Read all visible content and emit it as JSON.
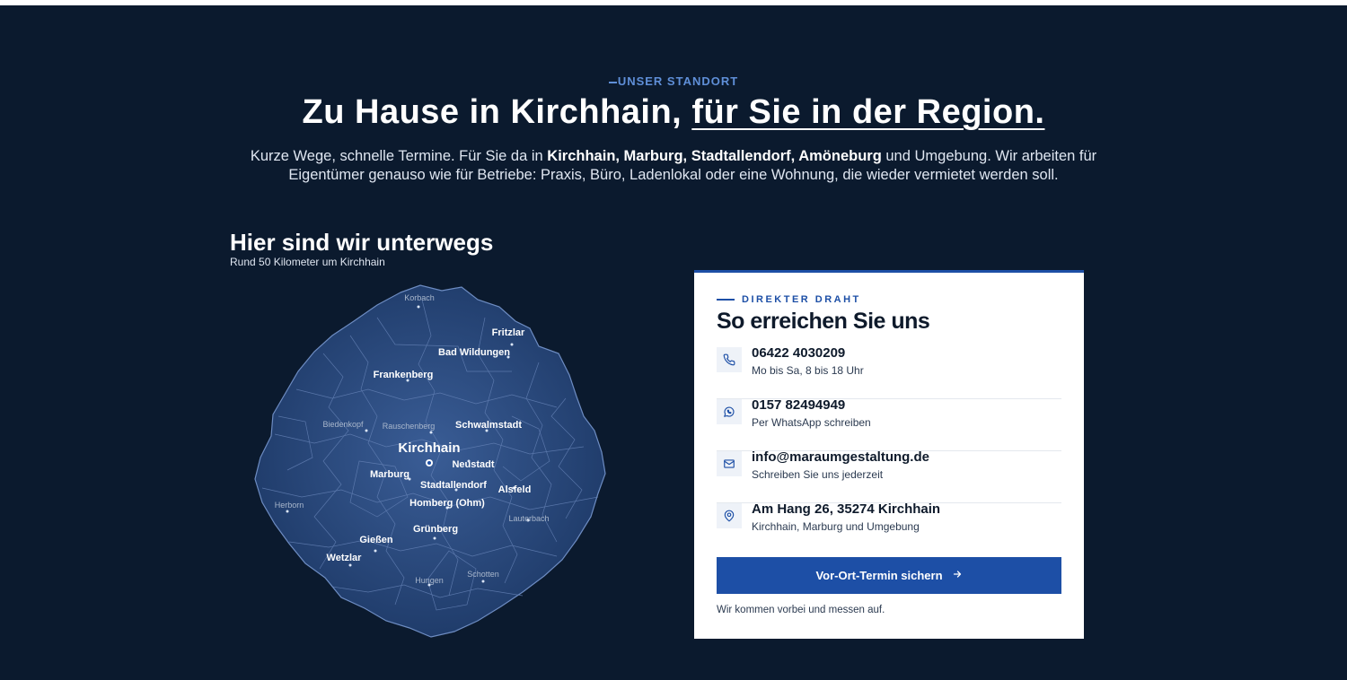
{
  "section": {
    "eyebrow": "UNSER STANDORT",
    "headline_part1": "Zu Hause in Kirchhain,",
    "headline_part2": "für Sie in der Region.",
    "intro": {
      "t1": "Kurze Wege, schnelle Termine. Für Sie da in ",
      "places": "Kirchhain, Marburg, Stadtallendorf, Amöneburg",
      "t2": " und Umgebung. Wir arbeiten für Eigentümer genauso wie für Betriebe: Praxis, Büro, Ladenlokal oder eine Wohnung, die wieder vermietet werden soll."
    }
  },
  "map": {
    "title": "Hier sind wir unterwegs",
    "subtitle": "Rund 50 Kilometer um Kirchhain",
    "center": "Kirchhain",
    "towns": [
      "Korbach",
      "Fritzlar",
      "Bad Wildungen",
      "Frankenberg",
      "Biedenkopf",
      "Rauschenberg",
      "Schwalmstadt",
      "Marburg",
      "Neustadt",
      "Stadtallendorf",
      "Alsfeld",
      "Herborn",
      "Homberg (Ohm)",
      "Lauterbach",
      "Grünberg",
      "Gießen",
      "Wetzlar",
      "Schotten",
      "Hungen"
    ],
    "colors": {
      "region_fill": "#2a4a7e",
      "region_stroke": "#5a7bb0"
    }
  },
  "contact": {
    "eyebrow": "DIREKTER DRAHT",
    "title": "So erreichen Sie uns",
    "items": [
      {
        "icon": "phone-icon",
        "main": "06422 4030209",
        "sub": "Mo bis Sa, 8 bis 18 Uhr"
      },
      {
        "icon": "whatsapp-icon",
        "main": "0157 82494949",
        "sub": "Per WhatsApp schreiben"
      },
      {
        "icon": "mail-icon",
        "main": "info@maraumgestaltung.de",
        "sub": "Schreiben Sie uns jederzeit"
      },
      {
        "icon": "location-pin-icon",
        "main": "Am Hang 26, 35274 Kirchhain",
        "sub": "Kirchhain, Marburg und Umgebung"
      }
    ],
    "cta_label": "Vor-Ort-Termin sichern",
    "cta_icon": "arrow-right-icon",
    "cta_note": "Wir kommen vorbei und messen auf.",
    "colors": {
      "accent": "#1d4fa6",
      "background": "#0b1a2e"
    }
  }
}
